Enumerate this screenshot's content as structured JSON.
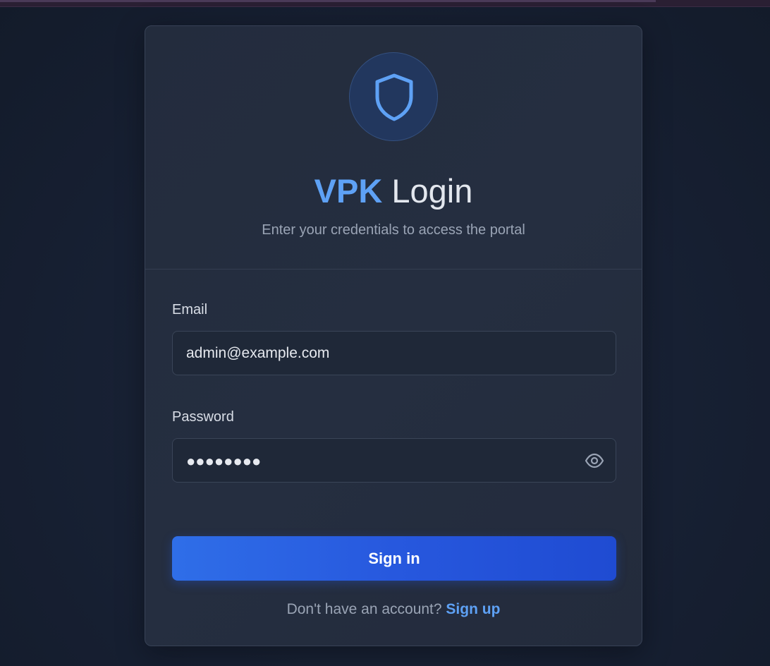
{
  "login": {
    "brand": "VPK",
    "title_suffix": " Login",
    "subtitle": "Enter your credentials to access the portal",
    "logo_icon": "shield-icon",
    "email": {
      "label": "Email",
      "value": "admin@example.com"
    },
    "password": {
      "label": "Password",
      "masked_value": "●●●●●●●●",
      "toggle_icon": "eye-icon"
    },
    "submit_label": "Sign in",
    "footer": {
      "prompt": "Don't have an account? ",
      "link_label": "Sign up"
    }
  },
  "colors": {
    "accent": "#5ea1f5",
    "button": "#2758de",
    "background": "#172033",
    "card": "#242d3f"
  }
}
